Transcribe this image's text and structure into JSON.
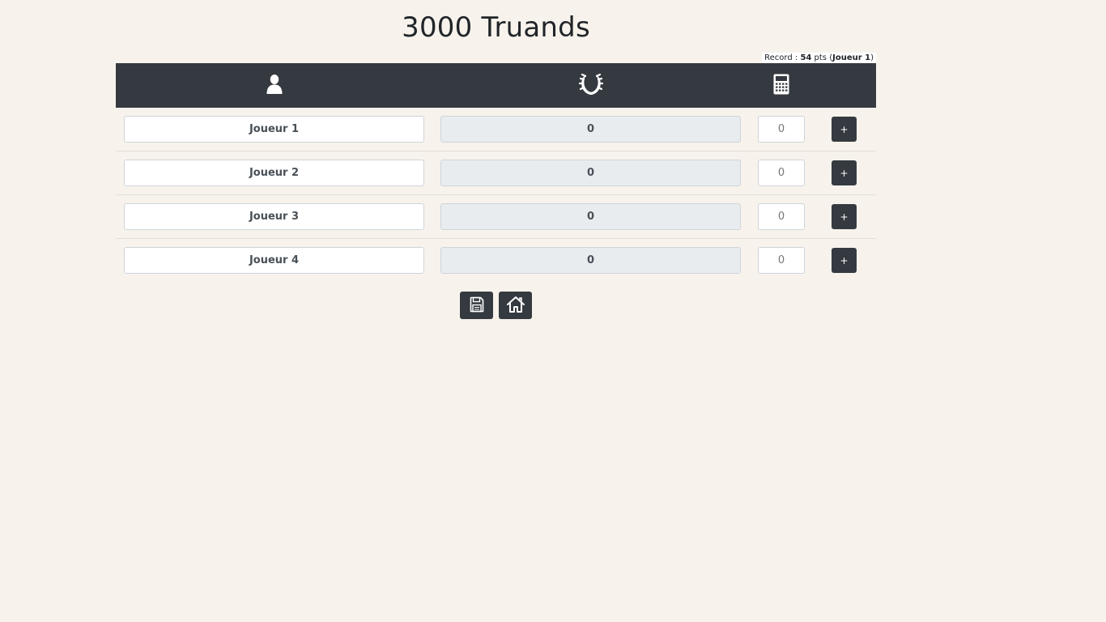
{
  "header": {
    "title": "3000 Truands"
  },
  "record": {
    "prefix": "Record : ",
    "points": "54",
    "unit": " pts (",
    "player": "Joueur 1",
    "suffix": ")"
  },
  "table": {
    "columns": [
      {
        "icon": "user-icon"
      },
      {
        "icon": "laurel-wreath-icon"
      },
      {
        "icon": "calculator-icon"
      }
    ],
    "rows": [
      {
        "name": "Joueur 1",
        "score": "0",
        "add_placeholder": "0",
        "add_label": "+"
      },
      {
        "name": "Joueur 2",
        "score": "0",
        "add_placeholder": "0",
        "add_label": "+"
      },
      {
        "name": "Joueur 3",
        "score": "0",
        "add_placeholder": "0",
        "add_label": "+"
      },
      {
        "name": "Joueur 4",
        "score": "0",
        "add_placeholder": "0",
        "add_label": "+"
      }
    ]
  },
  "actions": {
    "save_icon": "floppy-disk-icon",
    "home_icon": "home-icon"
  },
  "colors": {
    "background": "#f7f3ec",
    "dark": "#343a40",
    "score_bg": "#e9ecef"
  }
}
